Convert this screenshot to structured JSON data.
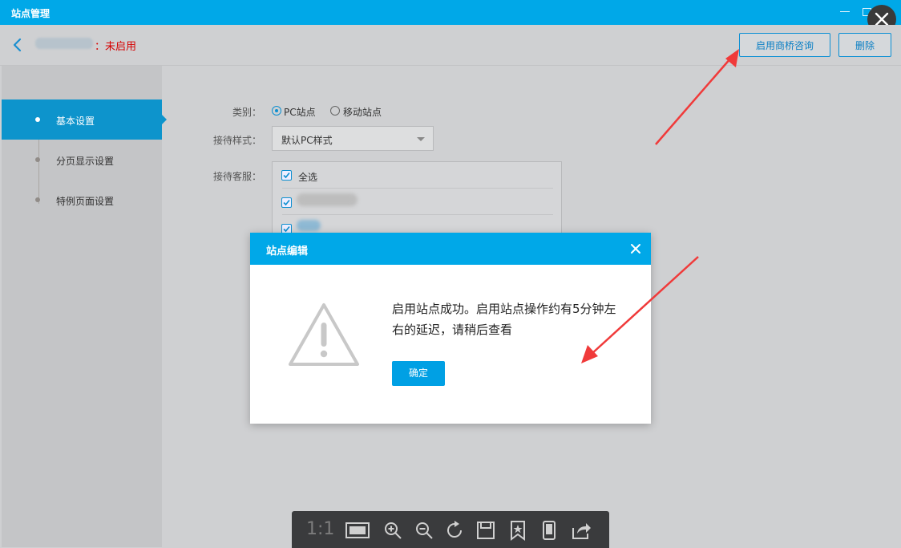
{
  "window": {
    "title": "站点管理"
  },
  "header": {
    "status": "：未启用",
    "enable_button": "启用商桥咨询",
    "delete_button": "删除"
  },
  "sidebar": {
    "items": [
      {
        "label": "基本设置",
        "active": true
      },
      {
        "label": "分页显示设置",
        "active": false
      },
      {
        "label": "特例页面设置",
        "active": false
      }
    ]
  },
  "form": {
    "category_label": "类别：",
    "category_options": [
      "PC站点",
      "移动站点"
    ],
    "style_label": "接待样式：",
    "style_value": "默认PC样式",
    "agent_label": "接待客服：",
    "select_all": "全选"
  },
  "modal": {
    "title": "站点编辑",
    "message": "启用站点成功。启用站点操作约有5分钟左右的延迟，请稍后查看",
    "ok_button": "确定"
  },
  "viewer_toolbar": {
    "ratio_label": "1:1",
    "icons": [
      "fit-screen-icon",
      "zoom-in-icon",
      "zoom-out-icon",
      "rotate-icon",
      "save-icon",
      "bookmark-icon",
      "tablet-icon",
      "share-icon"
    ]
  },
  "colors": {
    "accent": "#00a8e8",
    "status_red": "#d60000"
  }
}
